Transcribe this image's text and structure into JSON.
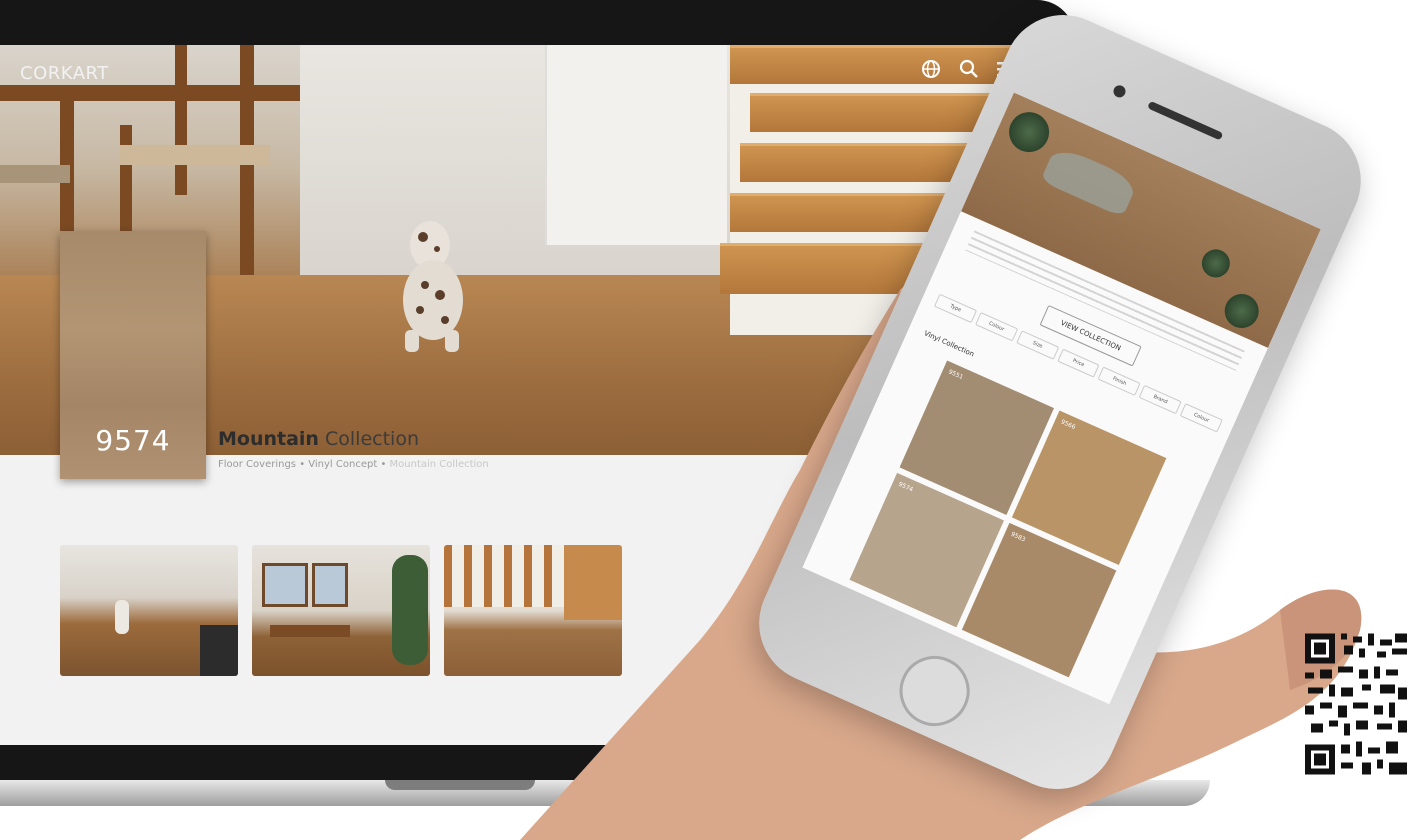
{
  "laptop": {
    "brand": "CORKART",
    "nav_icons": [
      "globe-icon",
      "search-icon",
      "menu-icon"
    ],
    "swatch": {
      "number": "9574",
      "color": "#a98b6a"
    },
    "title_bold": "Mountain",
    "title_rest": " Collection",
    "breadcrumb": {
      "level1": "Floor Coverings",
      "sep1": " • ",
      "level2": "Vinyl Concept",
      "sep2": " • ",
      "current": "Mountain Collection"
    },
    "gallery": [
      "living-room-with-dog",
      "dining-room",
      "staircase"
    ]
  },
  "phone": {
    "button": "VIEW COLLECTION",
    "filters": [
      "Type",
      "Colour",
      "Size",
      "Price",
      "Finish",
      "Brand",
      "Colour"
    ],
    "section_label": "Vinyl Collection",
    "tiles": [
      {
        "code": "9551",
        "color": "#a28c72"
      },
      {
        "code": "9566",
        "color": "#b99466"
      },
      {
        "code": "9574",
        "color": "#b7a48d"
      },
      {
        "code": "9583",
        "color": "#a88a68"
      }
    ]
  },
  "colors": {
    "laptop_bezel": "#161616",
    "screen_bg": "#f2f2f2",
    "wood_accent": "#a98b6a",
    "text_dark": "#2d2d2d",
    "text_muted": "#9a9a9a"
  }
}
